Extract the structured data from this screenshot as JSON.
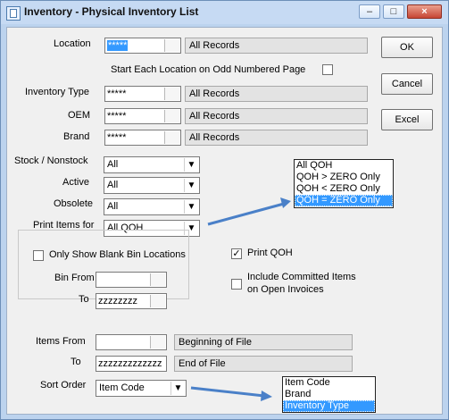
{
  "window": {
    "title": "Inventory - Physical Inventory List"
  },
  "buttons": {
    "ok": "OK",
    "cancel": "Cancel",
    "excel": "Excel"
  },
  "location": {
    "label": "Location",
    "value": "*****",
    "desc": "All Records"
  },
  "odd_page": {
    "label": "Start Each Location on Odd Numbered Page",
    "checked": false
  },
  "inventory_type": {
    "label": "Inventory Type",
    "value": "*****",
    "desc": "All Records"
  },
  "oem": {
    "label": "OEM",
    "value": "*****",
    "desc": "All Records"
  },
  "brand": {
    "label": "Brand",
    "value": "*****",
    "desc": "All Records"
  },
  "stock_nonstock": {
    "label": "Stock / Nonstock",
    "value": "All"
  },
  "active": {
    "label": "Active",
    "value": "All"
  },
  "obsolete": {
    "label": "Obsolete",
    "value": "All"
  },
  "print_items_for": {
    "label": "Print Items for",
    "value": "All QOH",
    "options": [
      "All QOH",
      "QOH > ZERO Only",
      "QOH < ZERO Only",
      "QOH = ZERO Only"
    ],
    "selected_index": 3
  },
  "only_blank_bins": {
    "label": "Only Show Blank Bin Locations",
    "checked": false
  },
  "bin_from": {
    "label": "Bin From",
    "value": ""
  },
  "bin_to": {
    "label": "To",
    "value": "zzzzzzzz"
  },
  "print_qoh": {
    "label": "Print QOH",
    "checked": true
  },
  "include_committed": {
    "label_line1": "Include Committed Items",
    "label_line2": "on Open Invoices",
    "checked": false
  },
  "items_from": {
    "label": "Items From",
    "value": "",
    "desc": "Beginning of File"
  },
  "items_to": {
    "label": "To",
    "value": "zzzzzzzzzzzzz",
    "desc": "End of File"
  },
  "sort_order": {
    "label": "Sort Order",
    "value": "Item Code",
    "options": [
      "Item Code",
      "Brand",
      "Inventory Type"
    ],
    "selected_index": 2
  },
  "colors": {
    "arrow": "#4a80c8",
    "selection": "#3399ff",
    "title_bg": "#c6daf3"
  }
}
